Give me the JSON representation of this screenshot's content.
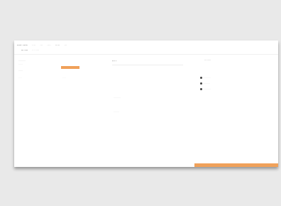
{
  "topbar": {
    "logo": "···· ····",
    "nav": [
      "····",
      "···",
      "····",
      "·····",
      "···"
    ]
  },
  "subbar": {
    "title": "··· ····",
    "crumbs": [
      "···· ····"
    ]
  },
  "left_panel": {
    "rows": [
      "··········",
      "······",
      "······",
      "·····",
      "·····"
    ],
    "accent_label": ""
  },
  "mid_panel": {
    "title": "··· ·",
    "rows": [
      "··········",
      "········"
    ]
  },
  "right_panel": {
    "title": "········",
    "legend": [
      "··········",
      "·········",
      "··········"
    ]
  },
  "bottom": {
    "action_label": ""
  },
  "colors": {
    "accent": "#f0a15a"
  }
}
